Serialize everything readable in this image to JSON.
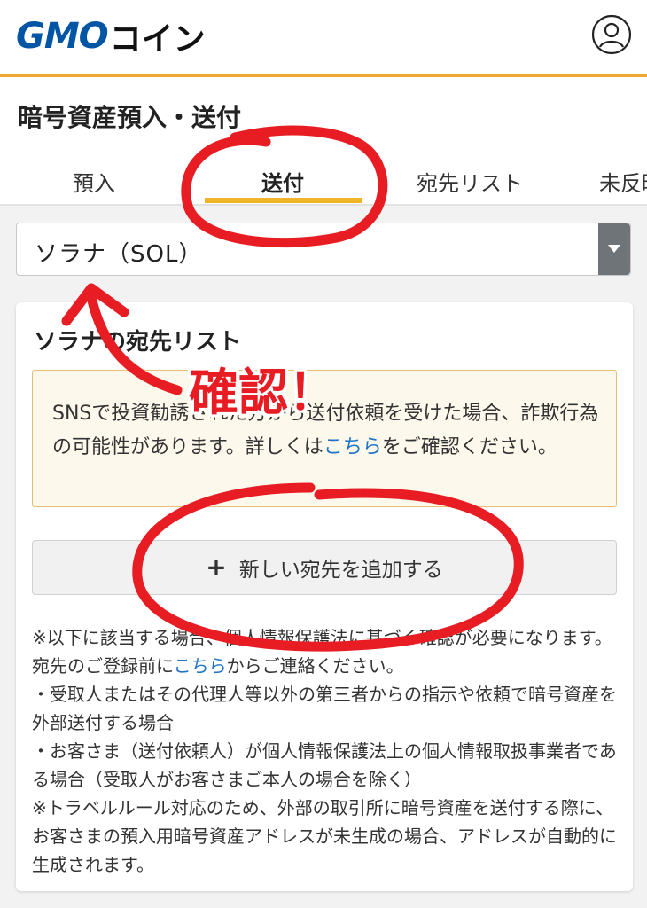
{
  "header": {
    "logo_brand": "GMO",
    "logo_suffix": "コイン",
    "account_icon": "user-circle-icon"
  },
  "page": {
    "title": "暗号資産預入・送付"
  },
  "tabs": [
    {
      "label": "預入",
      "active": false
    },
    {
      "label": "送付",
      "active": true
    },
    {
      "label": "宛先リスト",
      "active": false
    },
    {
      "label": "未反映",
      "active": false
    }
  ],
  "currency_select": {
    "value": "ソラナ（SOL）"
  },
  "card": {
    "title": "ソラナの宛先リスト",
    "warning": {
      "text_before": "SNSで投資勧誘された方から送付依頼を受けた場合、詐欺行為の可能性があります。詳しくは",
      "link": "こちら",
      "text_after": "をご確認ください。"
    },
    "add_button_label": "新しい宛先を追加する",
    "notes": {
      "line1_before": "※以下に該当する場合、個人情報保護法に基づく確認が必要になります。宛先のご登録前に",
      "line1_link": "こちら",
      "line1_after": "からご連絡ください。",
      "item1": "・受取人またはその代理人等以外の第三者からの指示や依頼で暗号資産を外部送付する場合",
      "item2": "・お客さま（送付依頼人）が個人情報保護法上の個人情報取扱事業者である場合（受取人がお客さまご本人の場合を除く）",
      "travel_rule": "※トラベルルール対応のため、外部の取引所に暗号資産を送付する際に、お客さまの預入用暗号資産アドレスが未生成の場合、アドレスが自動的に生成されます。"
    }
  },
  "annotation": {
    "label": "確認！",
    "color": "#e81d23"
  },
  "colors": {
    "accent_orange": "#f0a830",
    "tab_underline": "#f0b429",
    "brand_blue": "#0055a5",
    "link_blue": "#1f74c5"
  }
}
